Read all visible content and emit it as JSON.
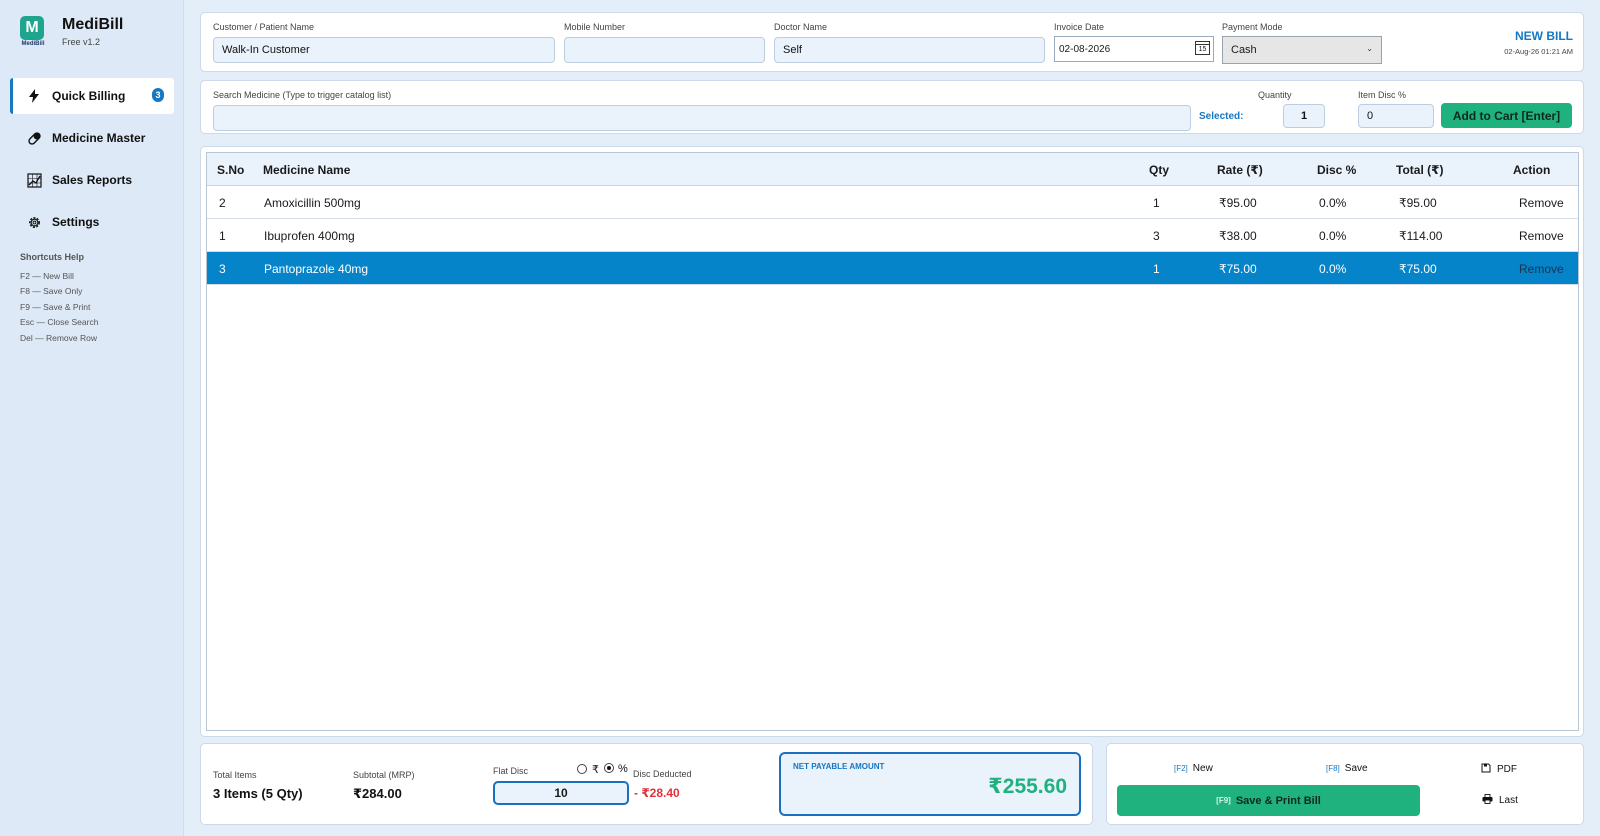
{
  "app": {
    "name": "MediBill",
    "version": "Free v1.2",
    "logo_letter": "M",
    "logo_sub": "MediBill"
  },
  "sidebar": {
    "items": [
      {
        "label": "Quick Billing",
        "icon": "bolt-icon",
        "badge": "3",
        "active": true
      },
      {
        "label": "Medicine Master",
        "icon": "pill-icon"
      },
      {
        "label": "Sales Reports",
        "icon": "chart-icon"
      },
      {
        "label": "Settings",
        "icon": "gear-icon"
      }
    ],
    "shortcuts_title": "Shortcuts Help",
    "shortcuts": [
      "F2  — New Bill",
      "F8  — Save Only",
      "F9  — Save & Print",
      "Esc — Close Search",
      "Del — Remove Row"
    ]
  },
  "header": {
    "customer_label": "Customer / Patient Name",
    "customer_value": "Walk-In Customer",
    "mobile_label": "Mobile Number",
    "mobile_value": "",
    "doctor_label": "Doctor Name",
    "doctor_value": "Self",
    "date_label": "Invoice Date",
    "date_value": "02-08-2026",
    "calendar_number": "15",
    "payment_label": "Payment Mode",
    "payment_value": "Cash",
    "bill_status": "NEW BILL",
    "bill_timestamp": "02-Aug-26 01:21 AM"
  },
  "search": {
    "label": "Search Medicine (Type to trigger catalog list)",
    "value": "",
    "selected_label": "Selected:",
    "quantity_label": "Quantity",
    "quantity_value": "1",
    "item_disc_label": "Item Disc %",
    "item_disc_value": "0",
    "add_button": "Add to Cart [Enter]"
  },
  "table": {
    "columns": [
      "S.No",
      "Medicine Name",
      "Qty",
      "Rate (₹)",
      "Disc %",
      "Total (₹)",
      "Action"
    ],
    "rows": [
      {
        "sno": "2",
        "name": "Amoxicillin 500mg",
        "qty": "1",
        "rate": "₹95.00",
        "disc": "0.0%",
        "total": "₹95.00",
        "action": "Remove",
        "selected": false
      },
      {
        "sno": "1",
        "name": "Ibuprofen 400mg",
        "qty": "3",
        "rate": "₹38.00",
        "disc": "0.0%",
        "total": "₹114.00",
        "action": "Remove",
        "selected": false
      },
      {
        "sno": "3",
        "name": "Pantoprazole 40mg",
        "qty": "1",
        "rate": "₹75.00",
        "disc": "0.0%",
        "total": "₹75.00",
        "action": "Remove",
        "selected": true
      }
    ]
  },
  "summary": {
    "total_items_label": "Total Items",
    "total_items_value": "3 Items (5 Qty)",
    "subtotal_label": "Subtotal (MRP)",
    "subtotal_value": "₹284.00",
    "flat_disc_label": "Flat Disc",
    "radio_rupee": "₹",
    "radio_percent": "%",
    "disc_mode": "percent",
    "disc_deducted_label": "Disc Deducted",
    "flat_disc_value": "10",
    "disc_deducted_value": "- ₹28.40",
    "net_label": "NET PAYABLE AMOUNT",
    "net_value": "₹255.60"
  },
  "actions": {
    "new_key": "[F2]",
    "new_label": "New",
    "save_key": "[F8]",
    "save_label": "Save",
    "pdf_label": "PDF",
    "print_key": "[F9]",
    "print_label": "Save & Print Bill",
    "last_label": "Last"
  },
  "colors": {
    "accent": "#1677c2",
    "green": "#1fb17e",
    "selected_row": "#0584c9",
    "discount_red": "#e0303a",
    "background": "#e4eef8"
  }
}
